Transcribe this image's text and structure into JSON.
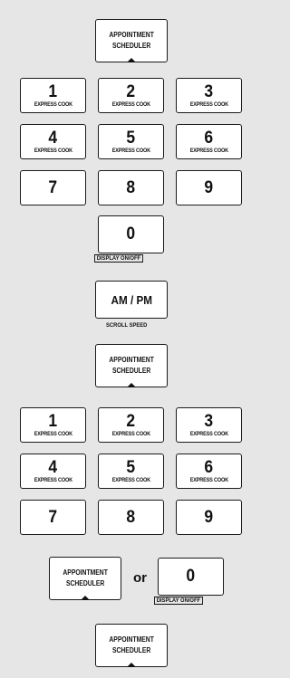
{
  "appointment_scheduler": {
    "line1": "APPOINTMENT",
    "line2": "SCHEDULER"
  },
  "express_cook": "EXPRESS COOK",
  "keypad": [
    "1",
    "2",
    "3",
    "4",
    "5",
    "6",
    "7",
    "8",
    "9"
  ],
  "zero": "0",
  "display_on_off": "DISPLAY ON/OFF",
  "ampm": "AM / PM",
  "scroll_speed": "SCROLL SPEED",
  "or": "or"
}
